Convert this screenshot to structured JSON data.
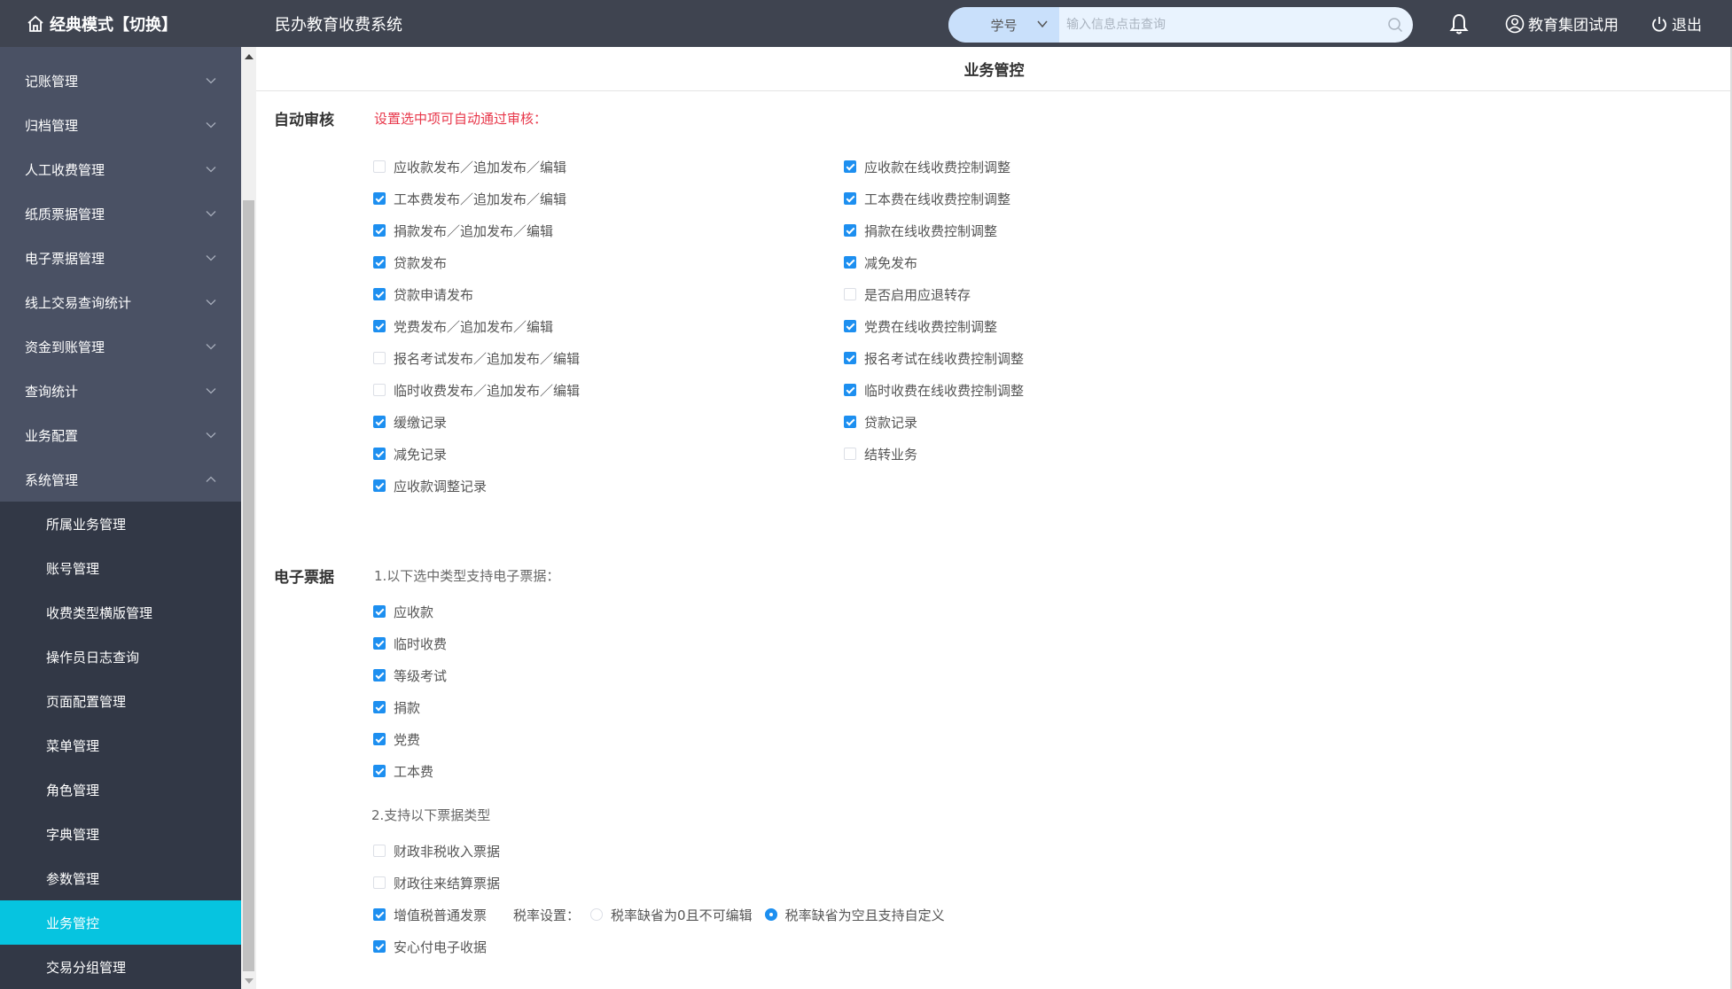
{
  "topbar": {
    "mode": "经典模式【切换】",
    "system_name": "民办教育收费系统",
    "search": {
      "type_value": "学号",
      "placeholder": "输入信息点击查询"
    },
    "user": "教育集团试用",
    "logout": "退出"
  },
  "sidebar": {
    "items": [
      {
        "label": "记账管理"
      },
      {
        "label": "归档管理"
      },
      {
        "label": "人工收费管理"
      },
      {
        "label": "纸质票据管理"
      },
      {
        "label": "电子票据管理"
      },
      {
        "label": "线上交易查询统计"
      },
      {
        "label": "资金到账管理"
      },
      {
        "label": "查询统计"
      },
      {
        "label": "业务配置"
      },
      {
        "label": "系统管理"
      }
    ],
    "sub_items": [
      {
        "label": "所属业务管理"
      },
      {
        "label": "账号管理"
      },
      {
        "label": "收费类型横版管理"
      },
      {
        "label": "操作员日志查询"
      },
      {
        "label": "页面配置管理"
      },
      {
        "label": "菜单管理"
      },
      {
        "label": "角色管理"
      },
      {
        "label": "字典管理"
      },
      {
        "label": "参数管理"
      },
      {
        "label": "业务管控"
      },
      {
        "label": "交易分组管理"
      }
    ]
  },
  "main": {
    "page_title": "业务管控",
    "auto_audit": {
      "label": "自动审核",
      "hint": "设置选中项可自动通过审核：",
      "left": [
        {
          "label": "应收款发布／追加发布／编辑",
          "checked": false
        },
        {
          "label": "工本费发布／追加发布／编辑",
          "checked": true
        },
        {
          "label": "捐款发布／追加发布／编辑",
          "checked": true
        },
        {
          "label": "贷款发布",
          "checked": true
        },
        {
          "label": "贷款申请发布",
          "checked": true
        },
        {
          "label": "党费发布／追加发布／编辑",
          "checked": true
        },
        {
          "label": "报名考试发布／追加发布／编辑",
          "checked": false
        },
        {
          "label": "临时收费发布／追加发布／编辑",
          "checked": false
        },
        {
          "label": "缓缴记录",
          "checked": true
        },
        {
          "label": "减免记录",
          "checked": true
        },
        {
          "label": "应收款调整记录",
          "checked": true
        }
      ],
      "right": [
        {
          "label": "应收款在线收费控制调整",
          "checked": true
        },
        {
          "label": "工本费在线收费控制调整",
          "checked": true
        },
        {
          "label": "捐款在线收费控制调整",
          "checked": true
        },
        {
          "label": "减免发布",
          "checked": true
        },
        {
          "label": "是否启用应退转存",
          "checked": false
        },
        {
          "label": "党费在线收费控制调整",
          "checked": true
        },
        {
          "label": "报名考试在线收费控制调整",
          "checked": true
        },
        {
          "label": "临时收费在线收费控制调整",
          "checked": true
        },
        {
          "label": "贷款记录",
          "checked": true
        },
        {
          "label": "结转业务",
          "checked": false
        }
      ]
    },
    "einvoice": {
      "label": "电子票据",
      "hint1": "1.以下选中类型支持电子票据：",
      "types": [
        {
          "label": "应收款",
          "checked": true
        },
        {
          "label": "临时收费",
          "checked": true
        },
        {
          "label": "等级考试",
          "checked": true
        },
        {
          "label": "捐款",
          "checked": true
        },
        {
          "label": "党费",
          "checked": true
        },
        {
          "label": "工本费",
          "checked": true
        }
      ],
      "hint2": "2.支持以下票据类型",
      "invoice_types": [
        {
          "label": "财政非税收入票据",
          "checked": false
        },
        {
          "label": "财政往来结算票据",
          "checked": false
        },
        {
          "label": "增值税普通发票",
          "checked": true
        },
        {
          "label": "安心付电子收据",
          "checked": true
        }
      ],
      "rate": {
        "label": "税率设置：",
        "option1": "税率缺省为0且不可编辑",
        "option2": "税率缺省为空且支持自定义",
        "selected": "option2"
      }
    }
  }
}
